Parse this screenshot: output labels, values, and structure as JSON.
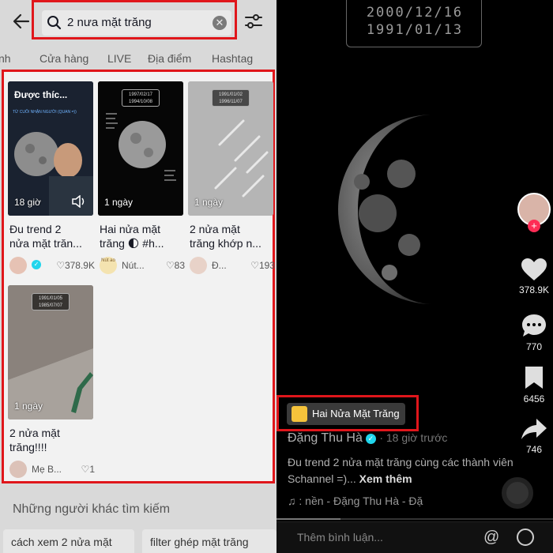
{
  "search": {
    "query": "2 nưa mặt trăng"
  },
  "tabs": [
    "nh",
    "Cửa hàng",
    "LIVE",
    "Địa điểm",
    "Hashtag"
  ],
  "results": [
    {
      "thumb_title": "Được thíc...",
      "thumb_subtitle": "TỪ CUỐI NHẬN NGƯỜI (QUAN =))",
      "time": "18 giờ",
      "caption1": "Đu trend 2",
      "caption2": "nửa mặt trăn...",
      "author": "",
      "likes": "378.9K",
      "dates": [
        "2000/12/16",
        "1991/01/13"
      ]
    },
    {
      "time": "1 ngày",
      "caption1": "Hai nửa mặt",
      "caption2": "trăng 🌓 #h...",
      "author": "Nút...",
      "avatar_text": "Nút ao",
      "likes": "83",
      "dates": [
        "1997/02/17",
        "1994/10/08"
      ]
    },
    {
      "time": "1 ngày",
      "caption1": "2 nửa mặt",
      "caption2": "trăng khớp n...",
      "author": "Đ...",
      "likes": "193",
      "dates": [
        "1991/01/02",
        "1996/11/07"
      ]
    },
    {
      "time": "1 ngày",
      "caption1": "2 nửa mặt",
      "caption2": "trăng!!!!",
      "author": "Mẹ B...",
      "likes": "1",
      "dates": [
        "1991/01/05",
        "1985/07/07"
      ]
    }
  ],
  "more": {
    "title": "Những người khác tìm kiếm",
    "suggestions": [
      "cách xem 2 nửa mặt",
      "filter ghép mặt trăng"
    ]
  },
  "video": {
    "dates": [
      "2000/12/16",
      "1991/01/13"
    ],
    "likes": "378.9K",
    "comments": "770",
    "saves": "6456",
    "shares": "746",
    "sound_label": "Hai Nửa Mặt Trăng",
    "author": "Đặng Thu Hà",
    "posted": "· 18 giờ trước",
    "desc": "Đu trend 2 nửa mặt trăng cùng các thành viên Schannel =)...",
    "see_more": "Xem thêm",
    "music": "♫ : nền - Đặng Thu Hà - Đặ",
    "comment_placeholder": "Thêm bình luận...",
    "progress": 0.23
  },
  "colors": {
    "highlight": "#e0161b",
    "verified": "#20d5ec",
    "like_red": "#fe2c55"
  }
}
